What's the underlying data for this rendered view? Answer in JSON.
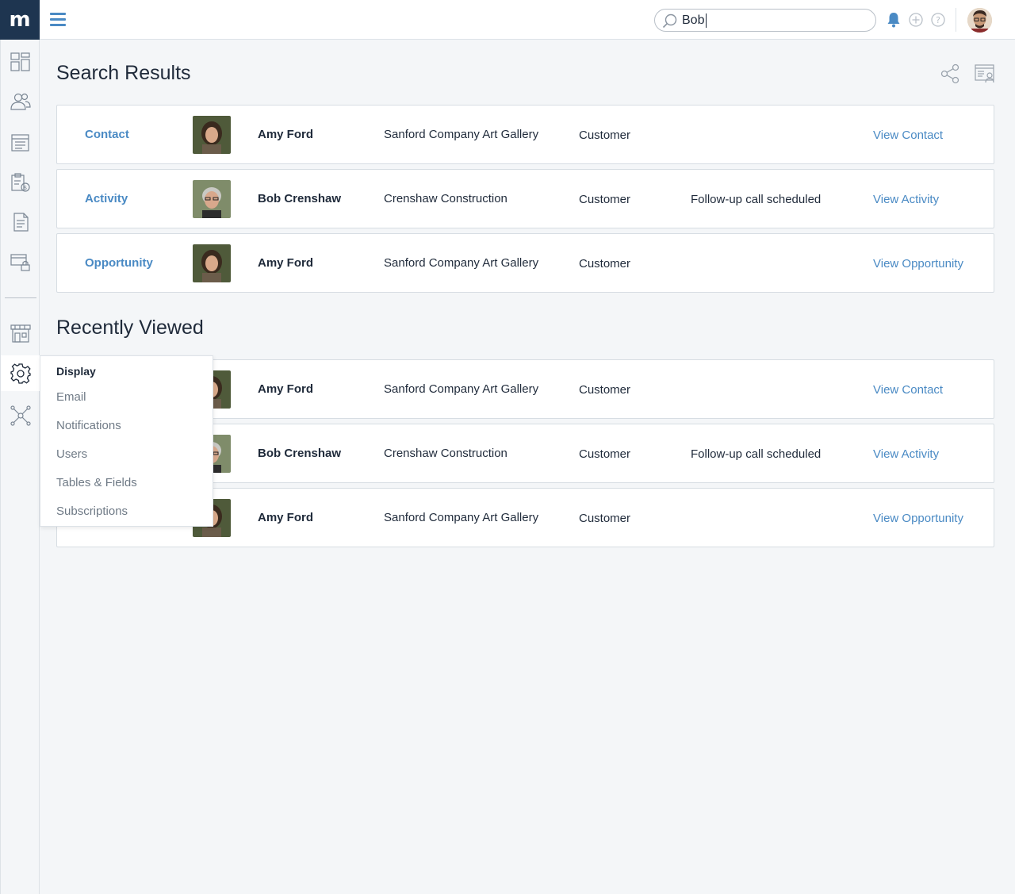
{
  "app": {
    "logo_text": "m",
    "brand_color": "#1e3550",
    "accent_color": "#4a8ac4"
  },
  "header": {
    "search_value": "Bob",
    "icons": [
      "bell-icon",
      "plus-circle-icon",
      "help-icon"
    ],
    "avatar": "user-avatar"
  },
  "sidebar": {
    "items": [
      {
        "icon": "dashboard-icon"
      },
      {
        "icon": "contacts-icon"
      },
      {
        "icon": "list-icon"
      },
      {
        "icon": "invoice-icon"
      },
      {
        "icon": "document-icon"
      },
      {
        "icon": "secure-payment-icon"
      },
      {
        "icon": "marketplace-icon"
      },
      {
        "icon": "settings-icon"
      },
      {
        "icon": "network-icon"
      }
    ]
  },
  "main": {
    "search_results_title": "Search Results",
    "recently_viewed_title": "Recently Viewed",
    "search_results": [
      {
        "type": "Contact",
        "name": "Amy Ford",
        "company": "Sanford Company Art Gallery",
        "role": "Customer",
        "note": "",
        "link": "View Contact"
      },
      {
        "type": "Activity",
        "name": "Bob Crenshaw",
        "company": "Crenshaw Construction",
        "role": "Customer",
        "note": "Follow-up call scheduled",
        "link": "View Activity"
      },
      {
        "type": "Opportunity",
        "name": "Amy Ford",
        "company": "Sanford Company Art Gallery",
        "role": "Customer",
        "note": "",
        "link": "View Opportunity"
      }
    ],
    "recently_viewed": [
      {
        "name": "Amy Ford",
        "company": "Sanford Company Art Gallery",
        "role": "Customer",
        "note": "",
        "link": "View Contact"
      },
      {
        "name": "Bob Crenshaw",
        "company": "Crenshaw Construction",
        "role": "Customer",
        "note": "Follow-up call scheduled",
        "link": "View Activity"
      },
      {
        "name": "Amy Ford",
        "company": "Sanford Company Art Gallery",
        "role": "Customer",
        "note": "",
        "link": "View Opportunity"
      }
    ]
  },
  "settings_menu": {
    "items": [
      "Display",
      "Email",
      "Notifications",
      "Users",
      "Tables & Fields",
      "Subscriptions"
    ]
  }
}
